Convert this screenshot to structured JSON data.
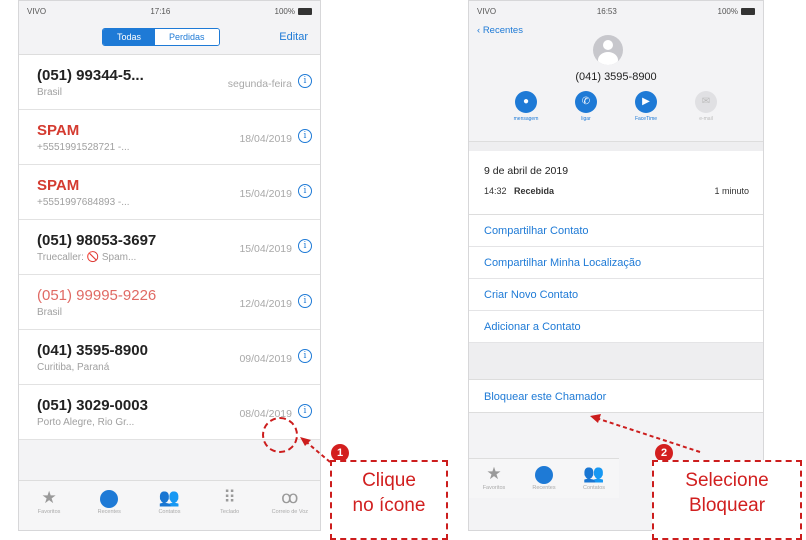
{
  "left_phone": {
    "status": {
      "carrier": "VIVO",
      "time": "17:16",
      "battery": "100%"
    },
    "segment": {
      "all_label": "Todas",
      "missed_label": "Perdidas"
    },
    "edit_label": "Editar",
    "calls": [
      {
        "name": "(051) 99344-5...",
        "sub": "Brasil",
        "date": "segunda-feira",
        "style": "normal"
      },
      {
        "name": "SPAM",
        "sub": "+5551991528721 -...",
        "date": "18/04/2019",
        "style": "red"
      },
      {
        "name": "SPAM",
        "sub": "+5551997684893 -...",
        "date": "15/04/2019",
        "style": "red"
      },
      {
        "name": "(051) 98053-3697",
        "sub": "Truecaller: 🚫 Spam...",
        "date": "15/04/2019",
        "style": "normal"
      },
      {
        "name": "(051) 99995-9226",
        "sub": "Brasil",
        "date": "12/04/2019",
        "style": "redlight"
      },
      {
        "name": "(041) 3595-8900",
        "sub": "Curitiba, Paraná",
        "date": "09/04/2019",
        "style": "normal"
      },
      {
        "name": "(051) 3029-0003",
        "sub": "Porto Alegre, Rio Gr...",
        "date": "08/04/2019",
        "style": "normal"
      }
    ],
    "tabs": [
      {
        "icon": "star-icon",
        "glyph": "★",
        "label": "Favoritos"
      },
      {
        "icon": "clock-icon",
        "glyph": "",
        "label": "Recentes"
      },
      {
        "icon": "contacts-icon",
        "glyph": "👥",
        "label": "Contatos"
      },
      {
        "icon": "keypad-icon",
        "glyph": "⠿",
        "label": "Teclado"
      },
      {
        "icon": "voicemail-icon",
        "glyph": "ꝏ",
        "label": "Correio de Voz"
      }
    ]
  },
  "right_phone": {
    "status": {
      "carrier": "VIVO",
      "time": "16:53",
      "battery": "100%"
    },
    "back_label": "Recentes",
    "phone_number": "(041) 3595-8900",
    "actions": [
      {
        "icon": "message-icon",
        "glyph": "●",
        "label": "mensagem",
        "enabled": true
      },
      {
        "icon": "phone-icon",
        "glyph": "✆",
        "label": "ligar",
        "enabled": true
      },
      {
        "icon": "video-icon",
        "glyph": "▶",
        "label": "FaceTime",
        "enabled": true
      },
      {
        "icon": "mail-icon",
        "glyph": "✉",
        "label": "e-mail",
        "enabled": false
      }
    ],
    "call_date": "9 de abril de 2019",
    "call_time": "14:32",
    "call_status": "Recebida",
    "call_duration": "1 minuto",
    "options": [
      "Compartilhar Contato",
      "Compartilhar Minha Localização",
      "Criar Novo Contato",
      "Adicionar a Contato"
    ],
    "block_label": "Bloquear este Chamador",
    "tabs": [
      {
        "icon": "star-icon",
        "glyph": "★",
        "label": "Favoritos"
      },
      {
        "icon": "clock-icon",
        "glyph": "",
        "label": "Recentes"
      },
      {
        "icon": "contacts-icon",
        "glyph": "👥",
        "label": "Contatos"
      }
    ]
  },
  "annotations": {
    "step1_number": "1",
    "step1_line1": "Clique",
    "step1_line2": "no ícone",
    "step2_number": "2",
    "step2_line1": "Selecione",
    "step2_line2": "Bloquear"
  },
  "colors": {
    "accent": "#1e7ad6",
    "spam": "#d43b30",
    "annotation": "#cc1d1d"
  }
}
